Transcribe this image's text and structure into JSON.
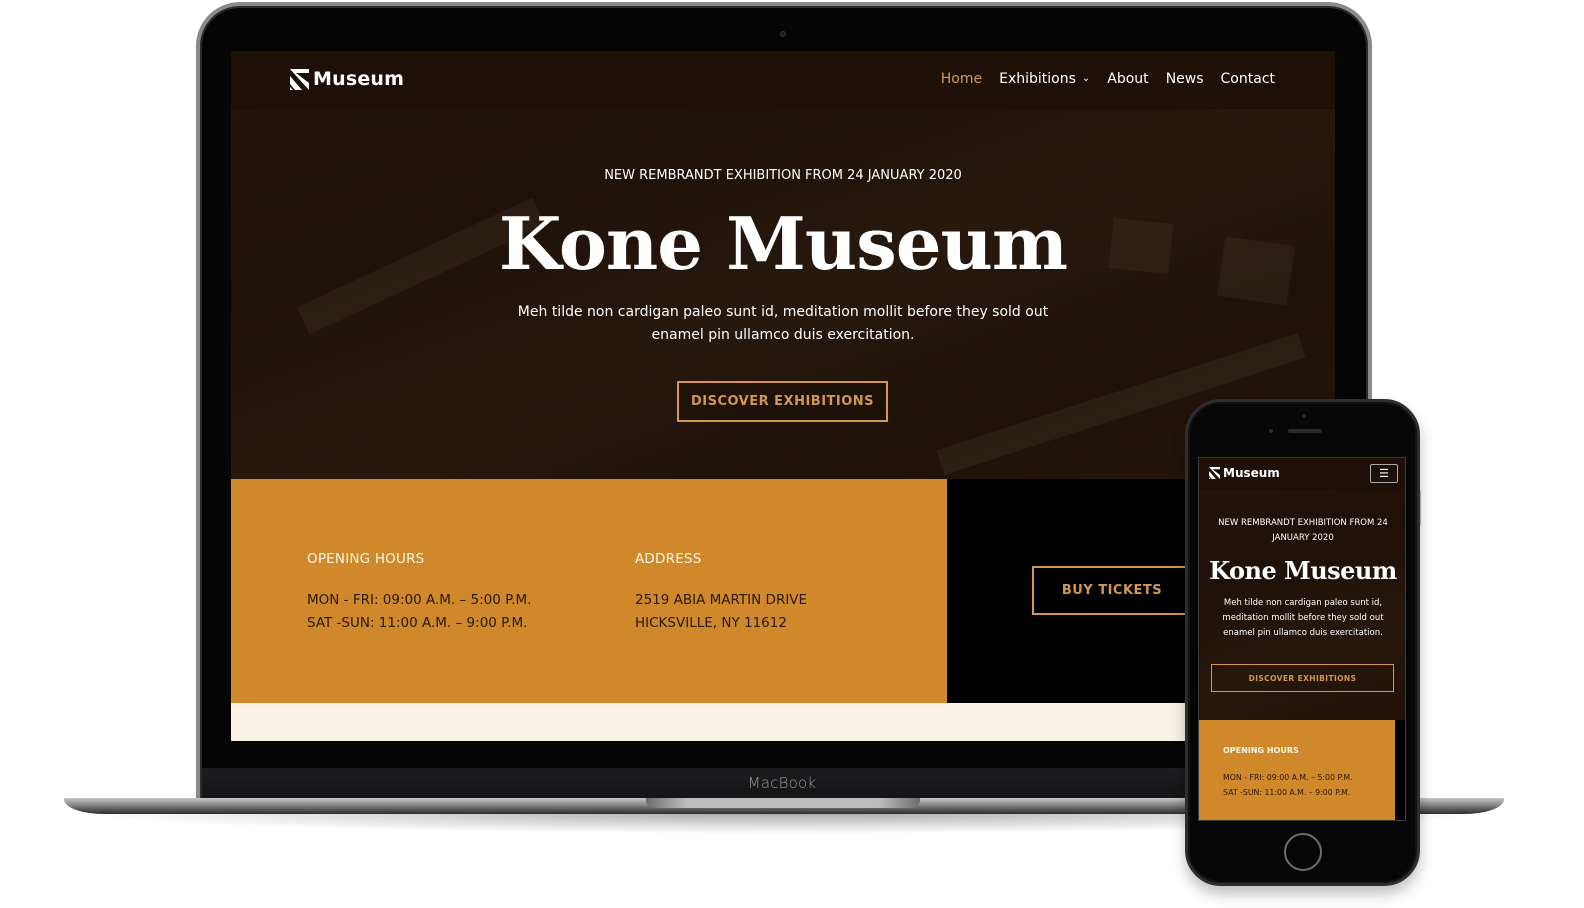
{
  "device_labels": {
    "laptop_brand": "MacBook"
  },
  "site": {
    "brand": "Museum",
    "nav": {
      "items": [
        {
          "label": "Home",
          "active": true
        },
        {
          "label": "Exhibitions",
          "has_dropdown": true
        },
        {
          "label": "About"
        },
        {
          "label": "News"
        },
        {
          "label": "Contact"
        }
      ]
    },
    "hero": {
      "eyebrow": "NEW REMBRANDT EXHIBITION FROM 24 JANUARY 2020",
      "title": "Kone Museum",
      "text_line1": "Meh tilde non cardigan paleo sunt id, meditation mollit before they sold out",
      "text_line2": "enamel pin ullamco duis exercitation.",
      "cta_label": "DISCOVER EXHIBITIONS"
    },
    "info": {
      "hours": {
        "heading": "OPENING HOURS",
        "lines": [
          "MON - FRI: 09:00 A.M. – 5:00 P.M.",
          "SAT -SUN: 11:00 A.M. – 9:00 P.M."
        ]
      },
      "address": {
        "heading": "ADDRESS",
        "lines": [
          "2519 ABIA MARTIN DRIVE",
          "HICKSVILLE, NY 11612"
        ]
      },
      "tickets_label": "BUY TICKETS"
    }
  },
  "mobile": {
    "brand": "Museum",
    "menu_icon": "hamburger-icon",
    "eyebrow": "NEW REMBRANDT EXHIBITION FROM 24 JANUARY 2020",
    "title": "Kone Museum",
    "text": "Meh tilde non cardigan paleo sunt id, meditation mollit before they sold out enamel pin ullamco duis exercitation.",
    "cta_label": "DISCOVER EXHIBITIONS",
    "hours_heading": "OPENING HOURS",
    "hours_lines": [
      "MON - FRI: 09:00 A.M. – 5:00 P.M.",
      "SAT -SUN: 11:00 A.M. – 9:00 P.M."
    ]
  },
  "colors": {
    "accent": "#d39754",
    "band": "#d0892a",
    "hero_bg": "#1e1007",
    "cream": "#fbf1e6"
  }
}
